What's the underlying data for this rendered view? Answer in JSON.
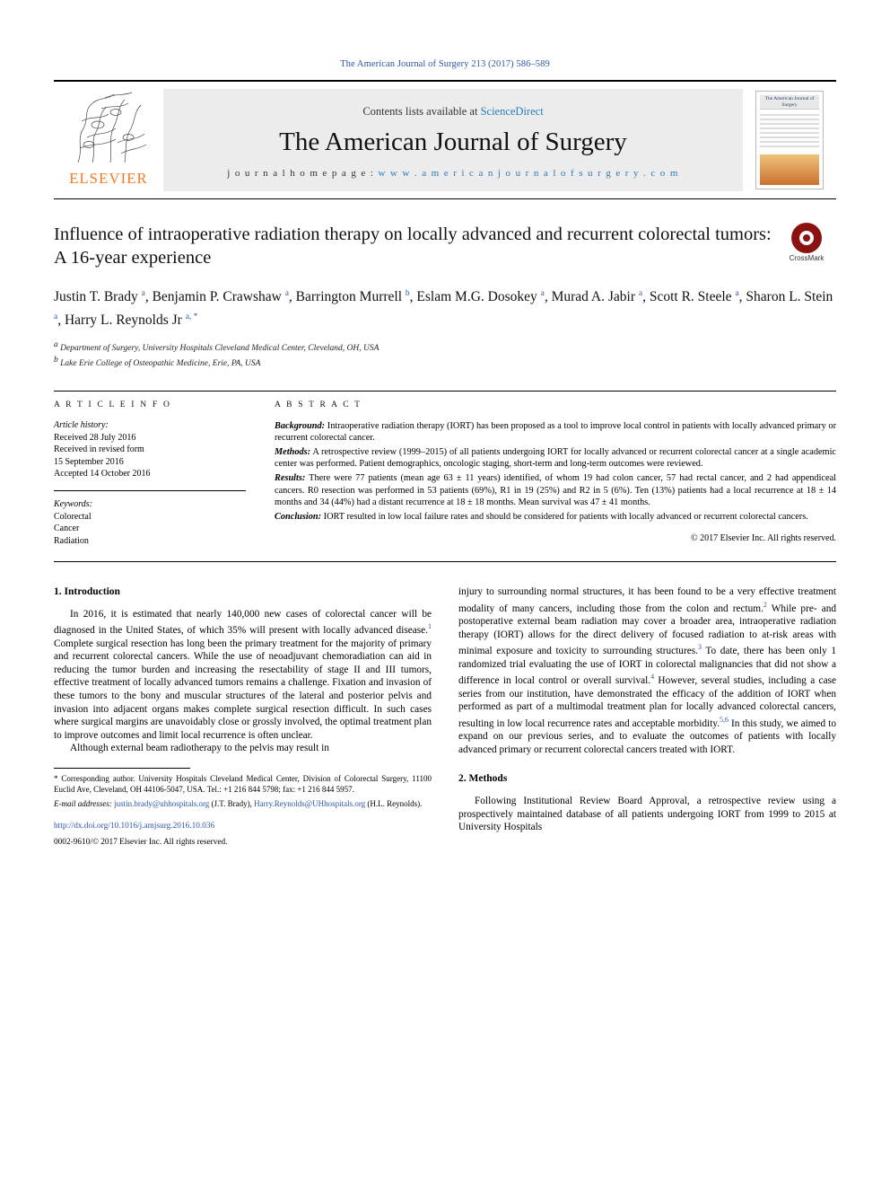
{
  "running_head": "The American Journal of Surgery 213 (2017) 586–589",
  "masthead": {
    "contents_prefix": "Contents lists available at ",
    "sciencedirect": "ScienceDirect",
    "journal_title": "The American Journal of Surgery",
    "homepage_prefix": "j o u r n a l   h o m e p a g e :   ",
    "homepage_url": "w w w . a m e r i c a n j o u r n a l o f s u r g e r y . c o m",
    "publisher": "ELSEVIER",
    "cover_title": "The American Journal of Surgery"
  },
  "article": {
    "title": "Influence of intraoperative radiation therapy on locally advanced and recurrent colorectal tumors: A 16-year experience",
    "crossmark_label": "CrossMark",
    "authors_html": "Justin T. Brady <sup class=\"sup-blue\">a</sup>, Benjamin P. Crawshaw <sup class=\"sup-blue\">a</sup>, Barrington Murrell <sup class=\"sup-blue\">b</sup>, Eslam M.G. Dosokey <sup class=\"sup-blue\">a</sup>, Murad A. Jabir <sup class=\"sup-blue\">a</sup>, Scott R. Steele <sup class=\"sup-blue\">a</sup>, Sharon L. Stein <sup class=\"sup-blue\">a</sup>, Harry L. Reynolds Jr <sup class=\"sup-blue\">a, *</sup>",
    "affiliation_a": "Department of Surgery, University Hospitals Cleveland Medical Center, Cleveland, OH, USA",
    "affiliation_b": "Lake Erie College of Osteopathic Medicine, Erie, PA, USA"
  },
  "article_info": {
    "section_heading": "A R T I C L E   I N F O",
    "history_title": "Article history:",
    "received": "Received 28 July 2016",
    "revised_label": "Received in revised form",
    "revised_date": "15 September 2016",
    "accepted": "Accepted 14 October 2016",
    "keywords_title": "Keywords:",
    "keywords": [
      "Colorectal",
      "Cancer",
      "Radiation"
    ]
  },
  "abstract": {
    "section_heading": "A B S T R A C T",
    "background_label": "Background:",
    "background_text": " Intraoperative radiation therapy (IORT) has been proposed as a tool to improve local control in patients with locally advanced primary or recurrent colorectal cancer.",
    "methods_label": "Methods:",
    "methods_text": " A retrospective review (1999–2015) of all patients undergoing IORT for locally advanced or recurrent colorectal cancer at a single academic center was performed. Patient demographics, oncologic staging, short-term and long-term outcomes were reviewed.",
    "results_label": "Results:",
    "results_text": " There were 77 patients (mean age 63 ± 11 years) identified, of whom 19 had colon cancer, 57 had rectal cancer, and 2 had appendiceal cancers. R0 resection was performed in 53 patients (69%), R1 in 19 (25%) and R2 in 5 (6%). Ten (13%) patients had a local recurrence at 18 ± 14 months and 34 (44%) had a distant recurrence at 18 ± 18 months. Mean survival was 47 ± 41 months.",
    "conclusion_label": "Conclusion:",
    "conclusion_text": " IORT resulted in low local failure rates and should be considered for patients with locally advanced or recurrent colorectal cancers.",
    "copyright": "© 2017 Elsevier Inc. All rights reserved."
  },
  "body": {
    "intro_heading": "1. Introduction",
    "intro_p1": "In 2016, it is estimated that nearly 140,000 new cases of colorectal cancer will be diagnosed in the United States, of which 35% will present with locally advanced disease.<sup class=\"ref-sup\">1</sup> Complete surgical resection has long been the primary treatment for the majority of primary and recurrent colorectal cancers. While the use of neoadjuvant chemoradiation can aid in reducing the tumor burden and increasing the resectability of stage II and III tumors, effective treatment of locally advanced tumors remains a challenge. Fixation and invasion of these tumors to the bony and muscular structures of the lateral and posterior pelvis and invasion into adjacent organs makes complete surgical resection difficult. In such cases where surgical margins are unavoidably close or grossly involved, the optimal treatment plan to improve outcomes and limit local recurrence is often unclear.",
    "intro_p2": "Although external beam radiotherapy to the pelvis may result in",
    "right_p1": "injury to surrounding normal structures, it has been found to be a very effective treatment modality of many cancers, including those from the colon and rectum.<sup class=\"ref-sup\">2</sup> While pre- and postoperative external beam radiation may cover a broader area, intraoperative radiation therapy (IORT) allows for the direct delivery of focused radiation to at-risk areas with minimal exposure and toxicity to surrounding structures.<sup class=\"ref-sup\">3</sup> To date, there has been only 1 randomized trial evaluating the use of IORT in colorectal malignancies that did not show a difference in local control or overall survival.<sup class=\"ref-sup\">4</sup> However, several studies, including a case series from our institution, have demonstrated the efficacy of the addition of IORT when performed as part of a multimodal treatment plan for locally advanced colorectal cancers, resulting in low local recurrence rates and acceptable morbidity.<sup class=\"ref-sup\">5,6</sup> In this study, we aimed to expand on our previous series, and to evaluate the outcomes of patients with locally advanced primary or recurrent colorectal cancers treated with IORT.",
    "methods_heading": "2. Methods",
    "methods_p1": "Following Institutional Review Board Approval, a retrospective review using a prospectively maintained database of all patients undergoing IORT from 1999 to 2015 at University Hospitals"
  },
  "footer": {
    "corresponding_marker": "*",
    "corresponding_text": "Corresponding author. University Hospitals Cleveland Medical Center, Division of Colorectal Surgery, 11100 Euclid Ave, Cleveland, OH 44106-5047, USA. Tel.: +1 216 844 5798; fax: +1 216 844 5957.",
    "email_label": "E-mail addresses:",
    "email_1": "justin.brady@uhhospitals.org",
    "email_1_owner": " (J.T. Brady), ",
    "email_2": "Harry.Reynolds@UHhospitals.org",
    "email_2_owner": " (H.L. Reynolds).",
    "doi": "http://dx.doi.org/10.1016/j.amjsurg.2016.10.036",
    "issn": "0002-9610/© 2017 Elsevier Inc. All rights reserved."
  }
}
